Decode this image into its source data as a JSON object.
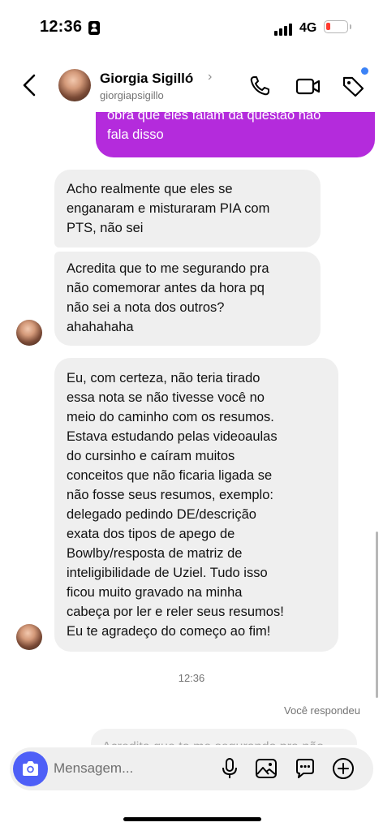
{
  "status_bar": {
    "time": "12:36",
    "network": "4G",
    "battery_color": "#ff3b30"
  },
  "header": {
    "back_icon": "chevron-left-icon",
    "contact_name": "Giorgia Sigilló",
    "name_chevron": "›",
    "contact_handle": "giorgiapsigillo",
    "actions": [
      "phone-icon",
      "video-icon",
      "tag-icon"
    ],
    "notification_dot_color": "#3b82f6"
  },
  "messages": {
    "outgoing_partial": "obra que eles falam da questão não\nfala disso",
    "outgoing_color": "#b42bdc",
    "incoming": [
      "Acho realmente que eles se\nenganaram e misturaram PIA com\nPTS, não sei",
      "Acredita que to me segurando pra\nnão comemorar antes da hora pq\nnão sei a nota dos outros?\nahahahaha",
      "Eu, com certeza, não teria tirado\nessa nota se não tivesse você no\nmeio do caminho com os resumos.\nEstava estudando pelas videoaulas\ndo cursinho e caíram muitos\nconceitos que não ficaria ligada se\nnão fosse seus resumos, exemplo:\ndelegado pedindo DE/descrição\nexata dos tipos de apego de\nBowlby/resposta de matriz de\ninteligibilidade de Uziel. Tudo isso\nficou muito gravado na minha\ncabeça por ler e reler seus resumos!\nEu te agradeço do começo ao fim!"
    ],
    "timestamp": "12:36",
    "replied_label": "Você respondeu",
    "reply_preview": "Acredita que to me segurando pra não"
  },
  "composer": {
    "placeholder": "Mensagem...",
    "camera_color": "#4e5ff7",
    "icons": [
      "camera-icon",
      "microphone-icon",
      "gallery-icon",
      "sticker-icon",
      "plus-icon"
    ]
  }
}
